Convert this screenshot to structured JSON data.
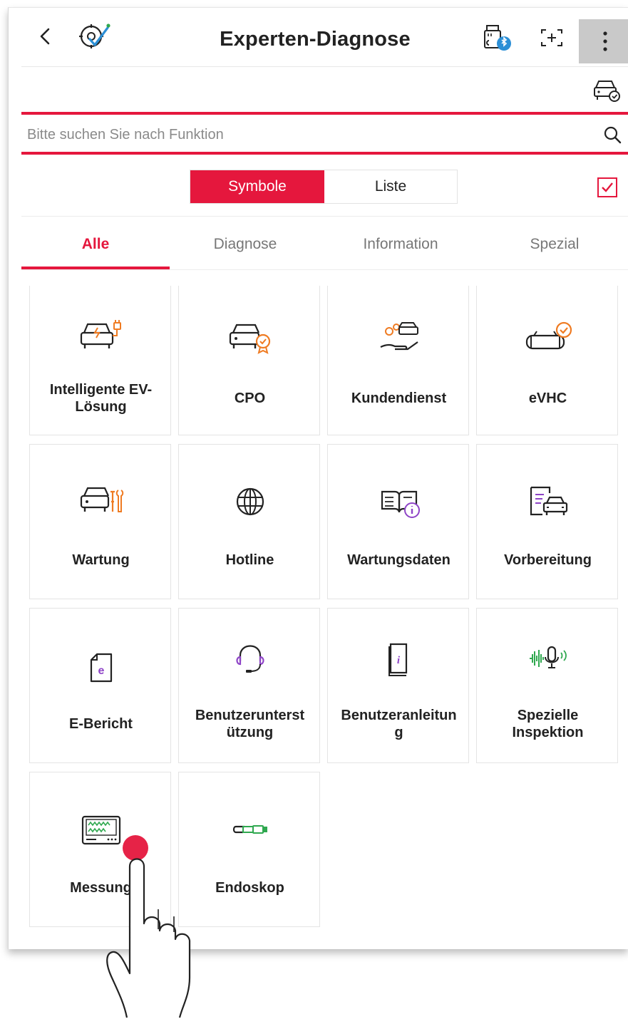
{
  "header": {
    "title": "Experten-Diagnose"
  },
  "search": {
    "placeholder": "Bitte suchen Sie nach Funktion"
  },
  "view_toggle": {
    "symbols_label": "Symbole",
    "list_label": "Liste",
    "selected": "Symbole"
  },
  "tabs": [
    {
      "label": "Alle"
    },
    {
      "label": "Diagnose"
    },
    {
      "label": "Information"
    },
    {
      "label": "Spezial"
    }
  ],
  "tiles": [
    {
      "label": "Intelligente EV-Lösung",
      "icon": "ev-car-charging-icon"
    },
    {
      "label": "CPO",
      "icon": "car-certified-icon"
    },
    {
      "label": "Kundendienst",
      "icon": "car-service-hand-icon"
    },
    {
      "label": "eVHC",
      "icon": "car-check-icon"
    },
    {
      "label": "Wartung",
      "icon": "car-tools-icon"
    },
    {
      "label": "Hotline",
      "icon": "globe-icon"
    },
    {
      "label": "Wartungsdaten",
      "icon": "book-info-icon"
    },
    {
      "label": "Vorbereitung",
      "icon": "document-car-icon"
    },
    {
      "label": "E-Bericht",
      "icon": "e-report-icon"
    },
    {
      "label": "Benutzerunterstützung",
      "label_lines": [
        "Benutzerunterst",
        "ützung"
      ],
      "icon": "headset-icon"
    },
    {
      "label": "Benutzeranleitung",
      "label_lines": [
        "Benutzeranleitun",
        "g"
      ],
      "icon": "manual-icon"
    },
    {
      "label": "Spezielle Inspektion",
      "label_lines": [
        "Spezielle",
        "Inspektion"
      ],
      "icon": "voice-inspection-icon"
    },
    {
      "label": "Messung",
      "icon": "oscilloscope-icon"
    },
    {
      "label": "Endoskop",
      "icon": "endoscope-icon"
    }
  ],
  "colors": {
    "accent": "#e5173d",
    "orange": "#ef7b22",
    "purple": "#8e44c7",
    "green": "#2fa84f"
  }
}
